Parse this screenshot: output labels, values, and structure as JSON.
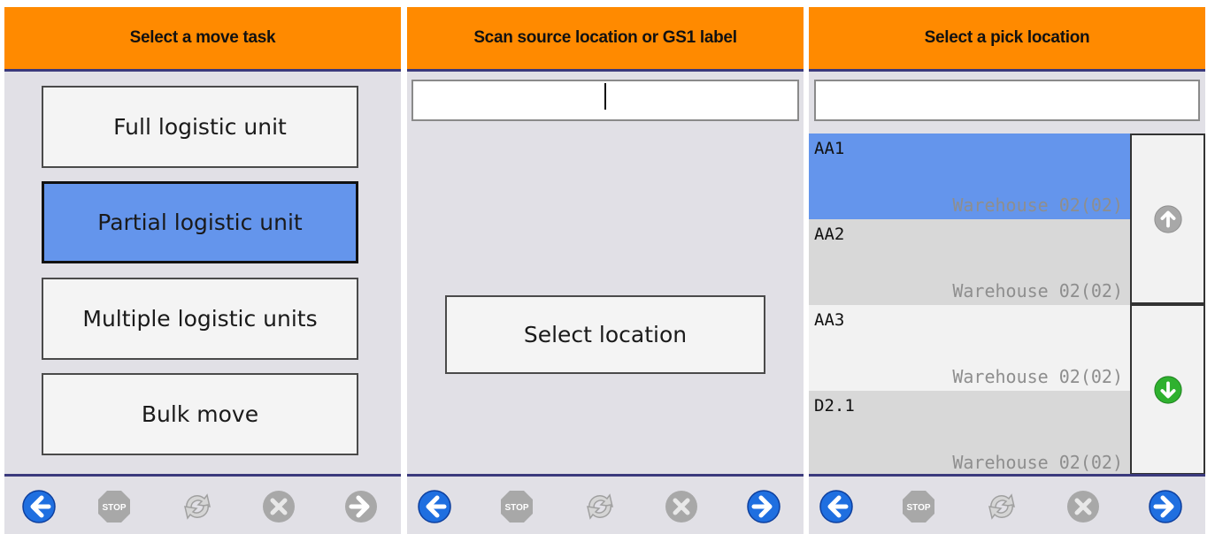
{
  "panels": [
    {
      "title": "Select a move task",
      "tasks": [
        {
          "label": "Full logistic unit",
          "selected": false
        },
        {
          "label": "Partial logistic unit",
          "selected": true
        },
        {
          "label": "Multiple logistic units",
          "selected": false
        },
        {
          "label": "Bulk move",
          "selected": false
        }
      ]
    },
    {
      "title": "Scan source location or GS1 label",
      "input_value": "",
      "select_location_label": "Select location"
    },
    {
      "title": "Select a pick location",
      "input_value": "",
      "locations": [
        {
          "name": "AA1",
          "warehouse": "Warehouse 02(02)",
          "selected": true
        },
        {
          "name": "AA2",
          "warehouse": "Warehouse 02(02)",
          "selected": false
        },
        {
          "name": "AA3",
          "warehouse": "Warehouse 02(02)",
          "selected": false
        },
        {
          "name": "D2.1",
          "warehouse": "Warehouse 02(02)",
          "selected": false
        }
      ]
    }
  ],
  "footer": {
    "back_icon": "arrow-left-circle-icon",
    "stop_icon": "stop-sign-icon",
    "stop_label": "STOP",
    "refresh_icon": "refresh-icon",
    "cancel_icon": "cancel-x-icon",
    "forward_icon": "arrow-right-circle-icon"
  },
  "colors": {
    "header": "#ff8a00",
    "header_border": "#3b3a7d",
    "panel_bg": "#e1e0e6",
    "selected": "#6495ec",
    "nav_blue": "#1f6fe0",
    "nav_disabled": "#a8a8a8",
    "scroll_down_green": "#2fb12f"
  }
}
